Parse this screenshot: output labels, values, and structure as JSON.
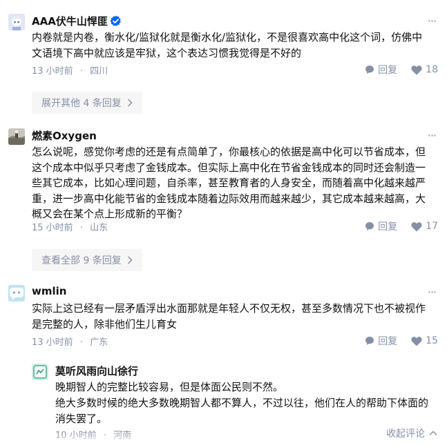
{
  "comments": [
    {
      "author": "AAA伏牛山悍匪",
      "verified": true,
      "text": "内卷就是内卷，衡水化/监狱化就是衡水化/监狱化，不是很喜欢高中化这个词，仿佛中文语境下高中就应该是牢狱，这个表达习惯我觉得是不好的",
      "time": "13 小时前",
      "location": "四川",
      "reply_label": "回复",
      "likes": "18",
      "expand_label": "展开其他 4 条回复"
    },
    {
      "author": "燃素Oxygen",
      "text": "怎么说呢，感觉你考虑的还是有点简单了，你最核心的依据是高中化可以节省成本，但这个成本中似乎只考虑了金钱成本。但实际上高中化在节省金钱成本的同时还会制造一些其它成本，比如心理问题，自杀率，甚至教育者的人身安全，而随着高中化越来越严重，进一步高中化能节省的金钱成本随着边际效用而越来越少，其它成本越来越高，大概又会在某个点上形成新的平衡？",
      "time": "15 小时前",
      "location": "山东",
      "reply_label": "回复",
      "likes": "17",
      "expand_label": "查看全部 9 条回复"
    },
    {
      "author": "wmlin",
      "text": "实际上这已经有一层矛盾浮出水面那就是年轻人不仅无权，甚至多数情况下也不被视作是完整的人，除非他们生儿育女",
      "time": "13 小时前",
      "location": "广东",
      "reply_label": "回复",
      "likes": "15"
    }
  ],
  "reply": {
    "author": "莫听风雨向山徐行",
    "line1": "晚期智人的完整比较容易，但是体面公民则不然。",
    "line2": "绝大多数时候的绝大多数晚期智人都不算人，不过以往，他们在人的帮助下体面的消失罢了。",
    "time": "10 小时前",
    "location": "河南"
  },
  "collapse_label": "收起评论",
  "separator": "·",
  "colors": {
    "meta": "#8590a6",
    "verified": "#0066ff",
    "expand_bg": "#f6f6f6"
  },
  "icons": [
    "verified-badge-icon",
    "more-icon",
    "comment-icon",
    "heart-icon",
    "chevron-right-icon",
    "chevron-up-icon"
  ]
}
